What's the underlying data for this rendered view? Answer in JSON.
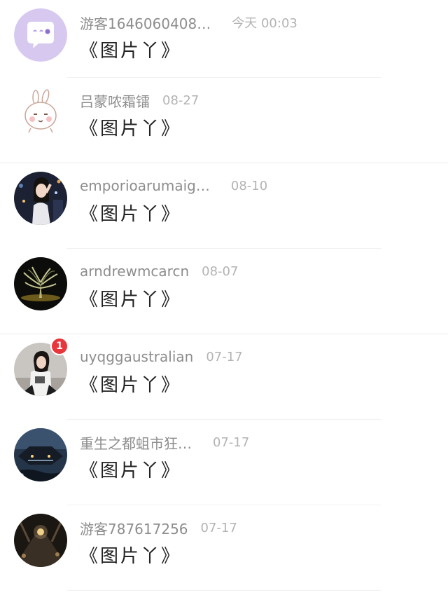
{
  "conversations": [
    {
      "name": "游客1646060408…",
      "time": "今天 00:03",
      "message": "《图片丫》",
      "avatar": "purple-chat-bubble-avatar"
    },
    {
      "name": "吕蒙哝霜镭",
      "time": "08-27",
      "message": "《图片丫》",
      "avatar": "cartoon-rabbit-avatar"
    },
    {
      "name": "emporioarumaig…",
      "time": "08-10",
      "message": "《图片丫》",
      "avatar": "woman-night-city-avatar"
    },
    {
      "name": "arndrewmcarcn",
      "time": "08-07",
      "message": "《图片丫》",
      "avatar": "glowing-tree-avatar"
    },
    {
      "name": "uyqggaustralian",
      "time": "07-17",
      "message": "《图片丫》",
      "avatar": "girl-sitting-avatar",
      "badge": "1"
    },
    {
      "name": "重生之都蛆市狂…",
      "time": "07-17",
      "message": "《图片丫》",
      "avatar": "sci-fi-ship-avatar"
    },
    {
      "name": "游客787617256",
      "time": "07-17",
      "message": "《图片丫》",
      "avatar": "dark-street-avatar"
    }
  ]
}
